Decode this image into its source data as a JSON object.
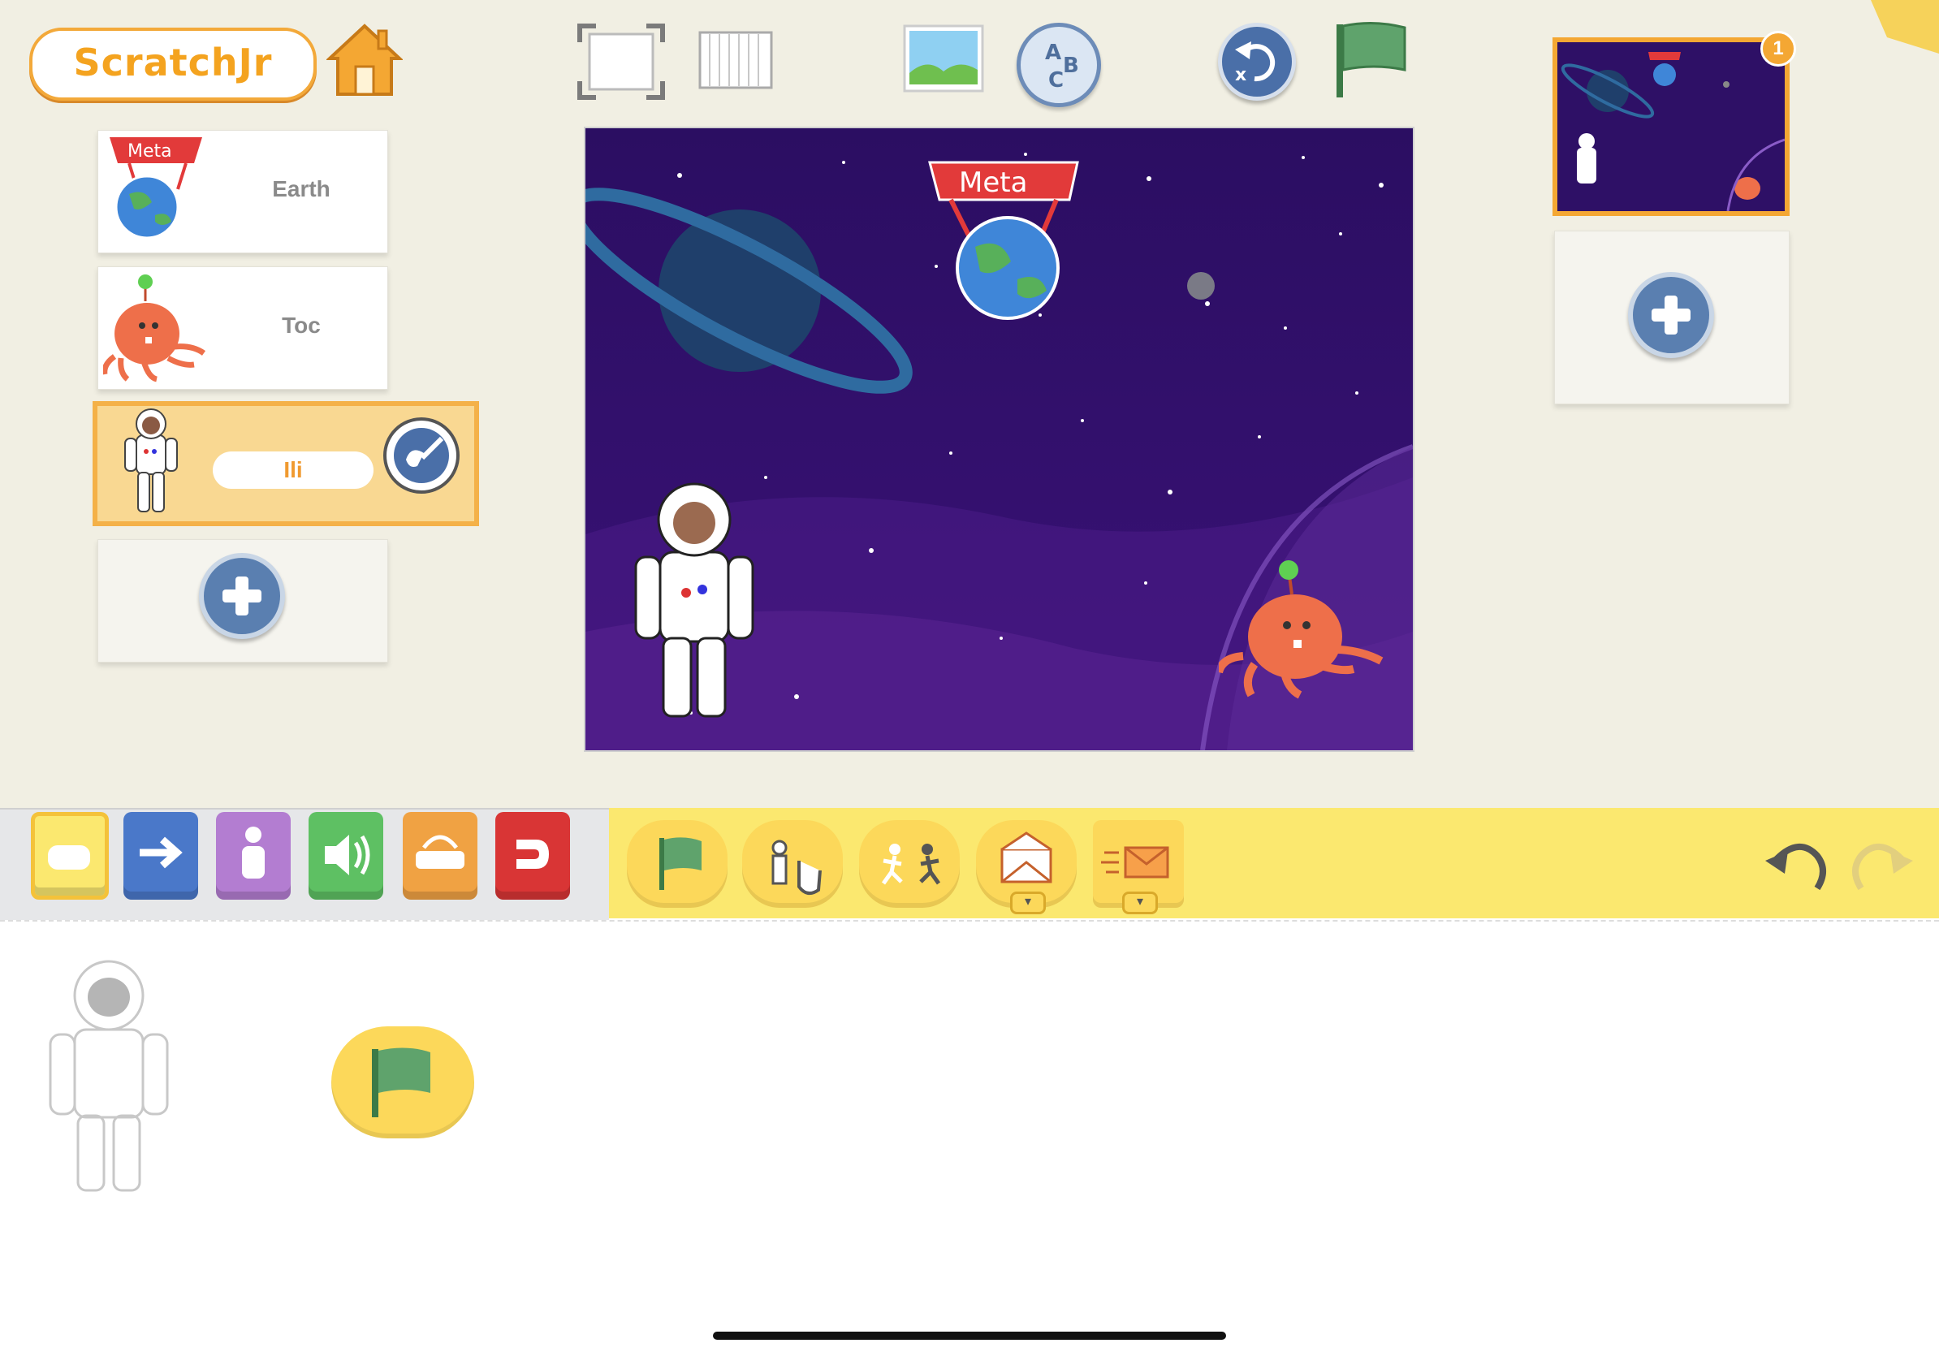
{
  "app": {
    "logo": "ScratchJr"
  },
  "toolbar": {
    "icons": [
      "home-icon",
      "fullscreen-icon",
      "grid-icon",
      "background-icon",
      "text-icon",
      "reset-icon",
      "green-flag-icon"
    ]
  },
  "sprites": [
    {
      "name": "Earth",
      "banner": "Meta"
    },
    {
      "name": "Toc"
    },
    {
      "name": "Ili",
      "selected": true
    }
  ],
  "stage": {
    "banner_text": "Meta"
  },
  "pages": {
    "count_badge": "1"
  },
  "categories": [
    {
      "name": "triggering",
      "color": "#fbe86f"
    },
    {
      "name": "motion",
      "color": "#4a78c9"
    },
    {
      "name": "looks",
      "color": "#b37dd1"
    },
    {
      "name": "sound",
      "color": "#5ec063"
    },
    {
      "name": "control",
      "color": "#f0a243"
    },
    {
      "name": "end",
      "color": "#d93535"
    }
  ],
  "palette_blocks": [
    "start-on-green-flag",
    "start-on-tap",
    "start-on-bump",
    "start-on-message",
    "send-message"
  ],
  "script_blocks": [
    "start-on-green-flag"
  ],
  "colors": {
    "accent": "#f7b43a",
    "stage_bg": "#2a0f5f",
    "block_yellow": "#fcd85a"
  }
}
